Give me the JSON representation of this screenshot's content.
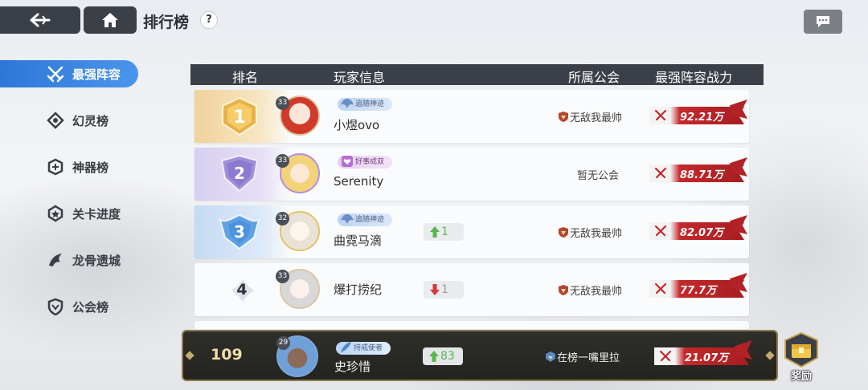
{
  "topbar": {
    "title": "排行榜",
    "help_label": "?"
  },
  "sidebar": {
    "items": [
      {
        "label": "最强阵容",
        "icon": "crossed-swords-icon",
        "active": true
      },
      {
        "label": "幻灵榜",
        "icon": "spirit-icon",
        "active": false
      },
      {
        "label": "神器榜",
        "icon": "artifact-icon",
        "active": false
      },
      {
        "label": "关卡进度",
        "icon": "stage-icon",
        "active": false
      },
      {
        "label": "龙骨遗城",
        "icon": "dragon-icon",
        "active": false
      },
      {
        "label": "公会榜",
        "icon": "guild-shield-icon",
        "active": false
      }
    ]
  },
  "table": {
    "headers": {
      "rank": "排名",
      "player": "玩家信息",
      "guild": "所属公会",
      "power": "最强阵容战力"
    },
    "rows": [
      {
        "rank": "1",
        "level": "33",
        "title": "追随神迹",
        "name": "小煜ovo",
        "change": "",
        "guild": "无敌我最帅",
        "power": "92.21万"
      },
      {
        "rank": "2",
        "level": "33",
        "title": "好事成双",
        "name": "Serenity",
        "change": "",
        "guild": "暂无公会",
        "power": "88.71万"
      },
      {
        "rank": "3",
        "level": "32",
        "title": "追随神迹",
        "name": "曲霓马滴",
        "change": "1",
        "change_dir": "up",
        "guild": "无敌我最帅",
        "power": "82.07万"
      },
      {
        "rank": "4",
        "level": "33",
        "title": "",
        "name": "爆打捞纪",
        "change": "1",
        "change_dir": "down",
        "guild": "无敌我最帅",
        "power": "77.7万"
      }
    ]
  },
  "self": {
    "rank": "109",
    "level": "29",
    "title": "持戒使者",
    "name": "史珍惜",
    "change": "83",
    "change_dir": "up",
    "guild": "在榜一嘴里拉",
    "power": "21.07万"
  },
  "reward": {
    "label": "奖励"
  },
  "colors": {
    "accent_blue": "#2e77d8",
    "header_dark": "#3b3f47",
    "gold_rank": "#f1d9a8",
    "silver_rank": "#dcd7f1",
    "bronze_rank": "#cfe0f5",
    "power_red": "#c5282b",
    "up_green": "#59b64d",
    "down_red": "#d9363a"
  }
}
